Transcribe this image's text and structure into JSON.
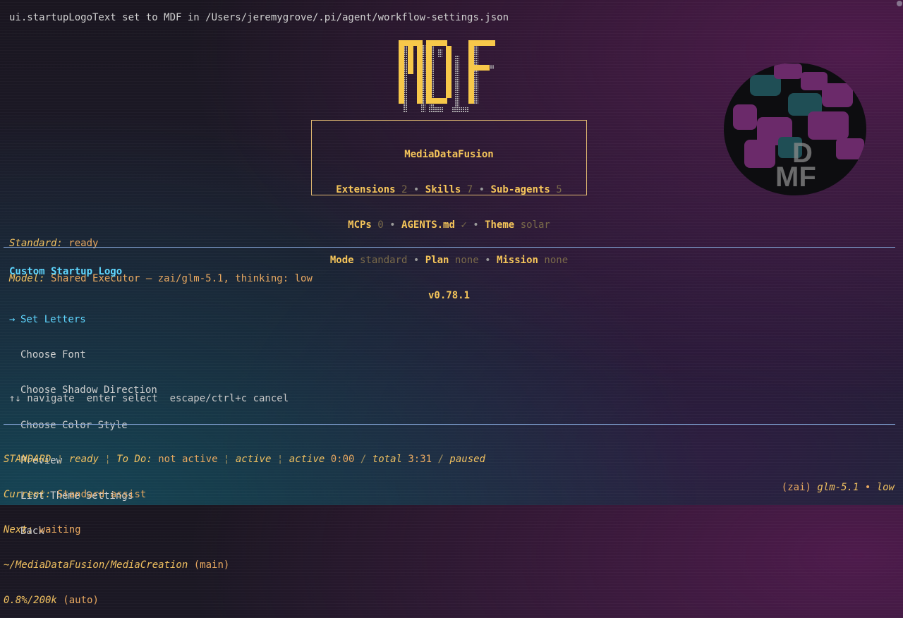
{
  "command_output": "ui.startupLogoText set to MDF in /Users/jeremygrove/.pi/agent/workflow-settings.json",
  "logo": {
    "text": "MDF",
    "icon": "mdf-pixel-logo"
  },
  "info_box": {
    "name": "MediaDataFusion",
    "extensions_label": "Extensions",
    "extensions_value": "2",
    "skills_label": "Skills",
    "skills_value": "7",
    "subagents_label": "Sub-agents",
    "subagents_value": "5",
    "mcps_label": "MCPs",
    "mcps_value": "0",
    "agents_label": "AGENTS.md",
    "agents_value": "✓",
    "theme_label": "Theme",
    "theme_value": "solar",
    "mode_label": "Mode",
    "mode_value": "standard",
    "plan_label": "Plan",
    "plan_value": "none",
    "mission_label": "Mission",
    "mission_value": "none",
    "version": "v0.78.1",
    "separator": "•"
  },
  "status": {
    "standard_label": "Standard:",
    "standard_value": "ready",
    "model_label": "Model:",
    "model_value": "Shared Executor – zai/glm-5.1, thinking: low"
  },
  "menu": {
    "title": "Custom Startup Logo",
    "selected_marker": "→",
    "items": [
      {
        "label": "Set Letters"
      },
      {
        "label": "Choose Font"
      },
      {
        "label": "Choose Shadow Direction"
      },
      {
        "label": "Choose Color Style"
      },
      {
        "label": "Preview"
      },
      {
        "label": "List Theme Settings"
      },
      {
        "label": "Back"
      }
    ],
    "help": "↑↓ navigate  enter select  escape/ctrl+c cancel"
  },
  "footer": {
    "mode": "STANDARD",
    "bar": "¦",
    "ready": "ready",
    "todo_label": "To Do:",
    "todo_value": "not active",
    "active1": "active",
    "active2_label": "active",
    "active2_time": "0:00",
    "slash": "/",
    "total_label": "total",
    "total_time": "3:31",
    "paused": "paused",
    "current_label": "Current:",
    "current_value": "Standard assist",
    "next_label": "Next:",
    "next_value": "waiting",
    "path": "~/MediaDataFusion/MediaCreation",
    "branch": "(main)",
    "context": "0.8%/200k",
    "context_mode": "(auto)",
    "provider": "(zai)",
    "model": "glm-5.1",
    "dot": "•",
    "thinking": "low"
  },
  "colors": {
    "accent": "#5fd7ff",
    "brand": "#f5c55a",
    "divider": "#7f9fd0"
  }
}
